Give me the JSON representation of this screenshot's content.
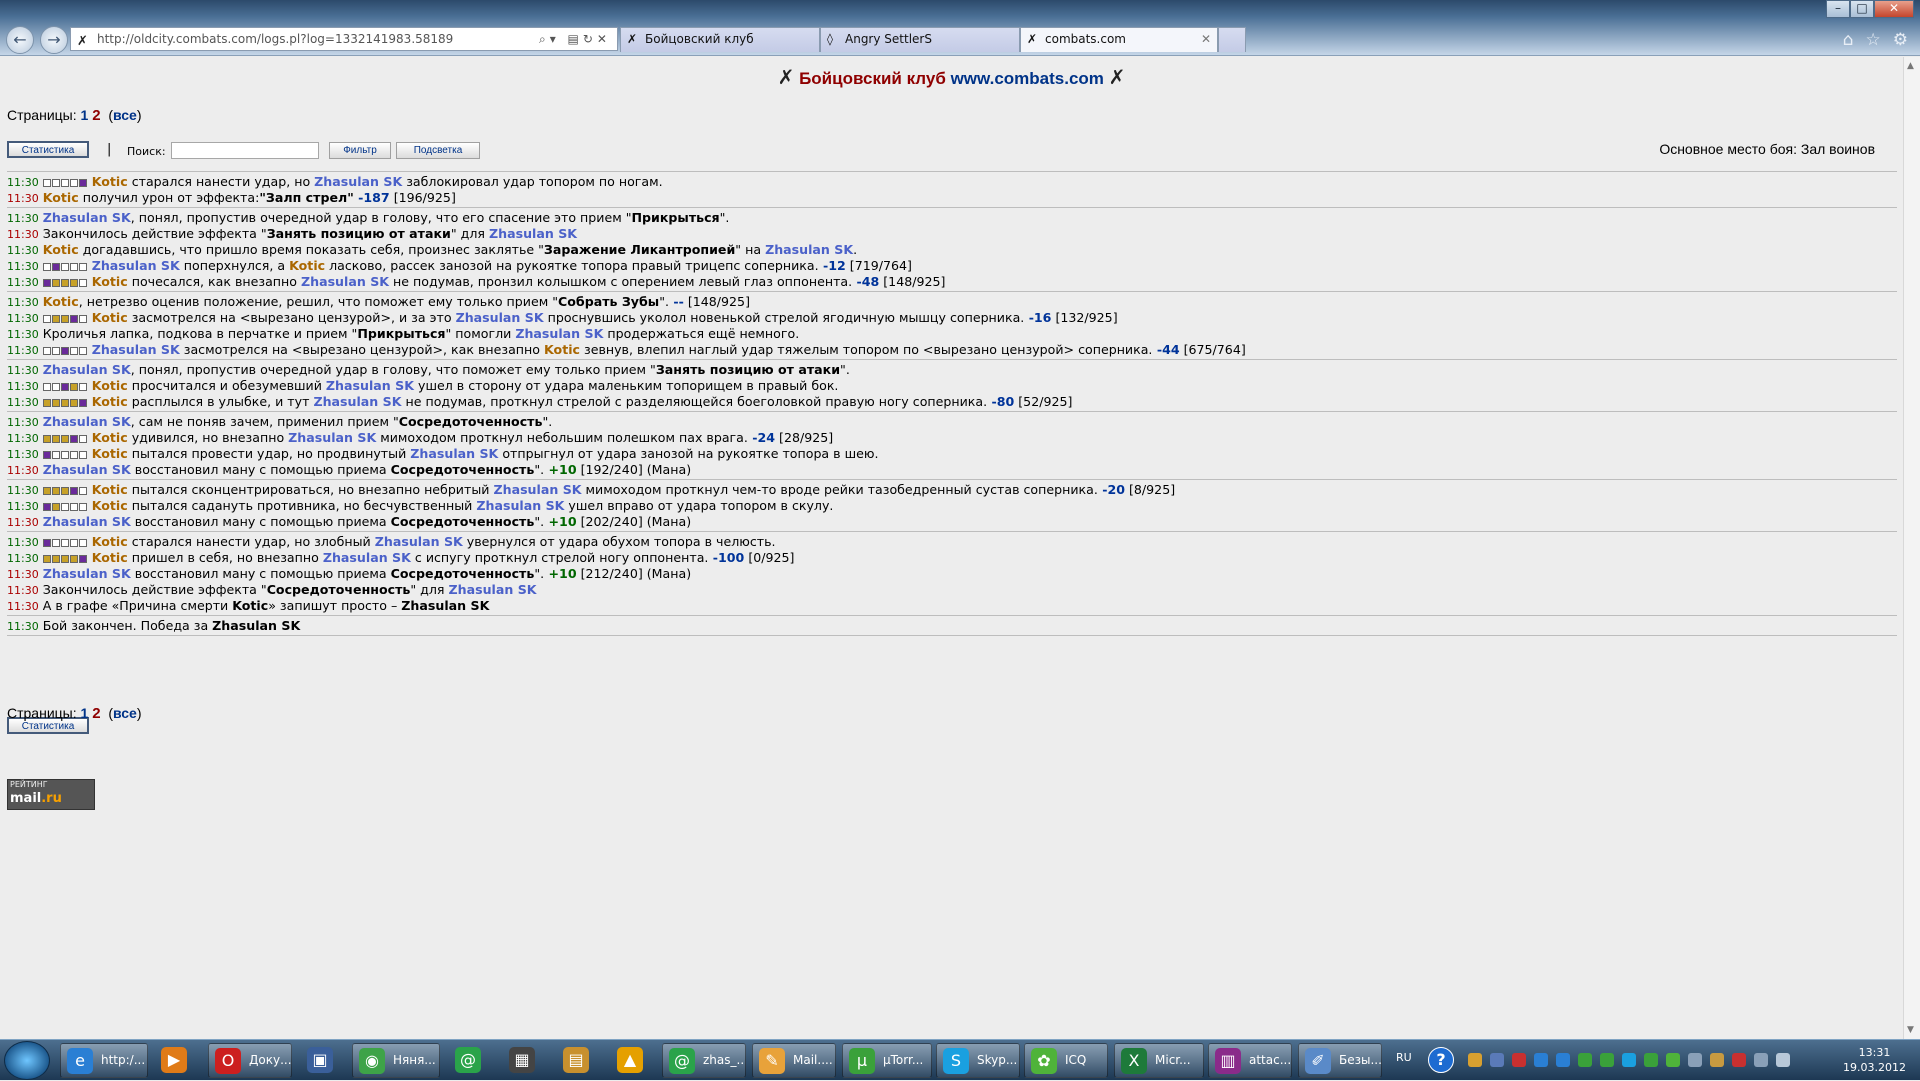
{
  "browser": {
    "url": "http://oldcity.combats.com/logs.pl?log=1332141983.58189",
    "tabs": [
      {
        "label": "Бойцовский клуб",
        "active": false
      },
      {
        "label": "Angry SettlerS",
        "active": false
      },
      {
        "label": "combats.com",
        "active": true
      }
    ]
  },
  "page": {
    "title_main": "Бойцовский клуб",
    "title_site": "www.combats.com",
    "pages_label": "Страницы:",
    "page1": "1",
    "page2": "2",
    "page_all": "все",
    "stats_button": "Статистика",
    "separator": "|",
    "search_label": "Поиск:",
    "search_value": "",
    "filter_button": "Фильтр",
    "highlight_button": "Подсветка",
    "battle_place": "Основное место боя: Зал воинов"
  },
  "log": {
    "l1": {
      "time": "11:30",
      "a": "Kotic",
      "t1": " старался нанести удар, но ",
      "b": "Zhasulan SK",
      "t2": " заблокировал удар топором по ногам."
    },
    "l2": {
      "time": "11:30",
      "a": "Kotic",
      "t1": " получил урон от эффекта:",
      "eff": "\"Залп стрел\"",
      "dmg": " -187",
      "hp": " [196/925]"
    },
    "l3": {
      "time": "11:30",
      "a": "Zhasulan SK",
      "t1": ", понял, пропустив очередной удар в голову, что его спасение это прием \"",
      "eff": "Прикрыться",
      "t2": "\"."
    },
    "l4": {
      "time": "11:30",
      "t1": "Закончилось действие эффекта \"",
      "eff": "Занять позицию от атаки",
      "t2": "\" для ",
      "b": "Zhasulan SK"
    },
    "l5": {
      "time": "11:30",
      "a": "Kotic",
      "t1": " догадавшись, что пришло время показать себя, произнес заклятье \"",
      "eff": "Заражение Ликантропией",
      "t2": "\" на ",
      "b": "Zhasulan SK",
      "t3": "."
    },
    "l6": {
      "time": "11:30",
      "a": "Zhasulan SK",
      "t1": " поперхнулся, а ",
      "b": "Kotic",
      "t2": " ласково, рассек занозой на рукоятке топора правый трицепс соперника.",
      "dmg": " -12",
      "hp": " [719/764]"
    },
    "l7": {
      "time": "11:30",
      "a": "Kotic",
      "t1": " почесался, как внезапно ",
      "b": "Zhasulan SK",
      "t2": " не подумав, пронзил колышком с оперением левый глаз оппонента.",
      "dmg": " -48",
      "hp": " [148/925]"
    },
    "l8": {
      "time": "11:30",
      "a": "Kotic",
      "t1": ", нетрезво оценив положение, решил, что поможет ему только прием \"",
      "eff": "Собрать Зубы",
      "t2": "\".",
      "dmg": " --",
      "hp": " [148/925]"
    },
    "l9": {
      "time": "11:30",
      "a": "Kotic",
      "t1": " засмотрелся на <вырезано цензурой>, и за это ",
      "b": "Zhasulan SK",
      "t2": " проснувшись уколол новенькой стрелой ягодичную мышцу соперника.",
      "dmg": " -16",
      "hp": " [132/925]"
    },
    "l10": {
      "time": "11:30",
      "t1": "Кроличья лапка, подкова в перчатке и прием \"",
      "eff": "Прикрыться",
      "t2": "\" помогли ",
      "b": "Zhasulan SK",
      "t3": " продержаться ещё немного."
    },
    "l11": {
      "time": "11:30",
      "a": "Zhasulan SK",
      "t1": " засмотрелся на <вырезано цензурой>, как внезапно ",
      "b": "Kotic",
      "t2": " зевнув, влепил наглый удар тяжелым топором по <вырезано цензурой> соперника.",
      "dmg": " -44",
      "hp": " [675/764]"
    },
    "l12": {
      "time": "11:30",
      "a": "Zhasulan SK",
      "t1": ", понял, пропустив очередной удар в голову, что поможет ему только прием \"",
      "eff": "Занять позицию от атаки",
      "t2": "\"."
    },
    "l13": {
      "time": "11:30",
      "a": "Kotic",
      "t1": " просчитался и обезумевший ",
      "b": "Zhasulan SK",
      "t2": " ушел в сторону от удара маленьким топорищем в правый бок."
    },
    "l14": {
      "time": "11:30",
      "a": "Kotic",
      "t1": " расплылся в улыбке, и тут ",
      "b": "Zhasulan SK",
      "t2": " не подумав, проткнул стрелой с разделяющейся боеголовкой правую ногу соперника.",
      "dmg": " -80",
      "hp": " [52/925]"
    },
    "l15": {
      "time": "11:30",
      "a": "Zhasulan SK",
      "t1": ", сам не поняв зачем, применил прием \"",
      "eff": "Сосредоточенность",
      "t2": "\"."
    },
    "l16": {
      "time": "11:30",
      "a": "Kotic",
      "t1": " удивился, но внезапно ",
      "b": "Zhasulan SK",
      "t2": " мимоходом проткнул небольшим полешком пах врага.",
      "dmg": " -24",
      "hp": " [28/925]"
    },
    "l17": {
      "time": "11:30",
      "a": "Kotic",
      "t1": " пытался провести удар, но продвинутый ",
      "b": "Zhasulan SK",
      "t2": " отпрыгнул от удара занозой на рукоятке топора в шею."
    },
    "l18": {
      "time": "11:30",
      "a": "Zhasulan SK",
      "t1": " восстановил ману с помощью приема ",
      "eff": "Сосредоточенность",
      "t2": "\".",
      "heal": " +10",
      "hp": " [192/240] (Мана)"
    },
    "l19": {
      "time": "11:30",
      "a": "Kotic",
      "t1": " пытался сконцентрироваться, но внезапно небритый ",
      "b": "Zhasulan SK",
      "t2": " мимоходом проткнул чем-то вроде рейки тазобедренный сустав соперника.",
      "dmg": " -20",
      "hp": " [8/925]"
    },
    "l20": {
      "time": "11:30",
      "a": "Kotic",
      "t1": " пытался садануть противника, но бесчувственный ",
      "b": "Zhasulan SK",
      "t2": " ушел вправо от удара топором в скулу."
    },
    "l21": {
      "time": "11:30",
      "a": "Zhasulan SK",
      "t1": " восстановил ману с помощью приема ",
      "eff": "Сосредоточенность",
      "t2": "\".",
      "heal": " +10",
      "hp": " [202/240] (Мана)"
    },
    "l22": {
      "time": "11:30",
      "a": "Kotic",
      "t1": " старался нанести удар, но злобный ",
      "b": "Zhasulan SK",
      "t2": " увернулся от удара обухом топора в челюсть."
    },
    "l23": {
      "time": "11:30",
      "a": "Kotic",
      "t1": " пришел в себя, но внезапно ",
      "b": "Zhasulan SK",
      "t2": " с испугу проткнул стрелой ногу оппонента.",
      "dmg": " -100",
      "hp": " [0/925]"
    },
    "l24": {
      "time": "11:30",
      "a": "Zhasulan SK",
      "t1": " восстановил ману с помощью приема ",
      "eff": "Сосредоточенность",
      "t2": "\".",
      "heal": " +10",
      "hp": " [212/240] (Мана)"
    },
    "l25": {
      "time": "11:30",
      "t1": "Закончилось действие эффекта \"",
      "eff": "Сосредоточенность",
      "t2": "\" для ",
      "b": "Zhasulan SK"
    },
    "l26": {
      "time": "11:30",
      "t1": "А в графе «Причина смерти ",
      "a": "Kotic",
      "t2": "» запишут просто – ",
      "b": "Zhasulan SK"
    },
    "l27": {
      "time": "11:30",
      "t1": "Бой закончен. Победа за ",
      "b": "Zhasulan SK"
    }
  },
  "rating": {
    "top": "РЕЙТИНГ",
    "mail": "mail",
    "ru": ".ru"
  },
  "taskbar": {
    "items": [
      "http:/...",
      "Доку...",
      "Няня...",
      "zhas_...",
      "Mail....",
      "µTorr...",
      "Skyp...",
      "ICQ",
      "Micr...",
      "attac...",
      "Безы..."
    ],
    "lang": "RU",
    "time": "13:31",
    "date": "19.03.2012"
  },
  "colors": {
    "kotic": "#aa6700",
    "zhasulan": "#4b61c9",
    "damage": "#003399",
    "heal": "#006600",
    "title": "#8f0000"
  }
}
